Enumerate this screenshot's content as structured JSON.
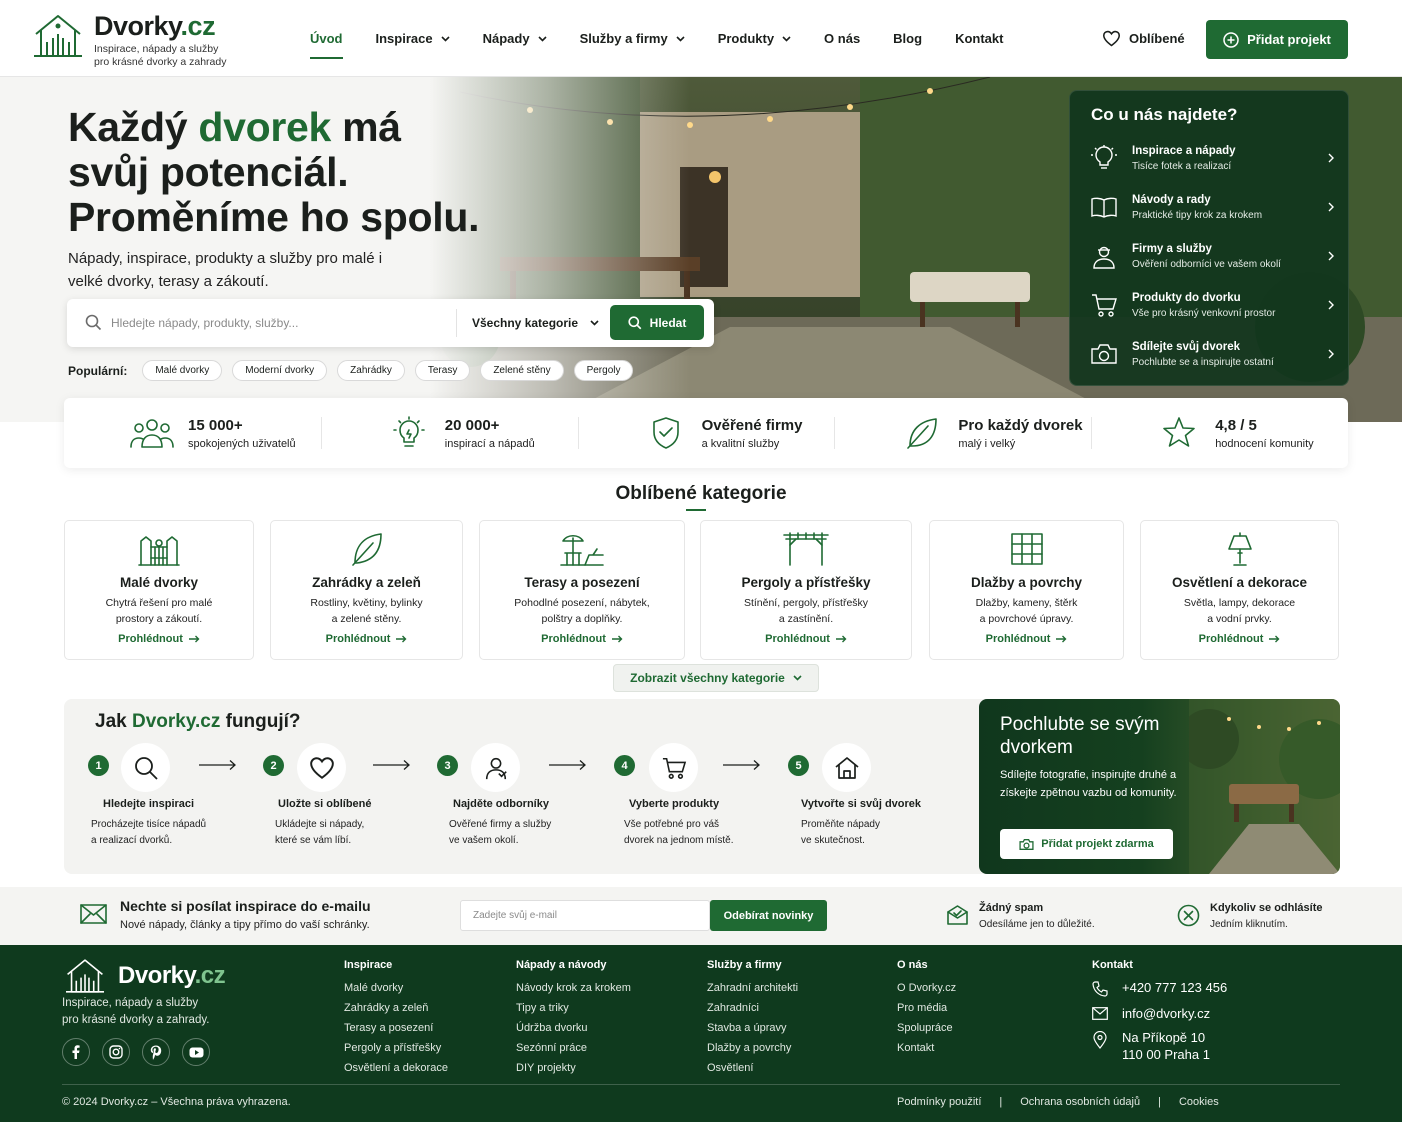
{
  "brand": {
    "name_main": "Dvorky",
    "name_suffix": ".cz",
    "tagline_1": "Inspirace, nápady a služby",
    "tagline_2": "pro krásné dvorky a zahrady"
  },
  "nav": {
    "items": [
      {
        "label": "Úvod",
        "dropdown": false,
        "active": true
      },
      {
        "label": "Inspirace",
        "dropdown": true
      },
      {
        "label": "Nápady",
        "dropdown": true
      },
      {
        "label": "Služby a firmy",
        "dropdown": true
      },
      {
        "label": "Produkty",
        "dropdown": true
      },
      {
        "label": "O nás",
        "dropdown": false
      },
      {
        "label": "Blog",
        "dropdown": false
      },
      {
        "label": "Kontakt",
        "dropdown": false
      }
    ],
    "favorites": "Oblíbené",
    "add_project": "Přidat projekt"
  },
  "hero": {
    "title_1": "Každý ",
    "title_accent": "dvorek",
    "title_2": " má svůj potenciál. Proměníme ho spolu.",
    "subtitle": "Nápady, inspirace, produkty a služby pro malé i velké dvorky, terasy a zákoutí.",
    "search_placeholder": "Hledejte nápady, produkty, služby...",
    "search_category": "Všechny kategorie",
    "search_button": "Hledat",
    "popular_label": "Populární:",
    "popular_tags": [
      "Malé dvorky",
      "Moderní dvorky",
      "Zahrádky",
      "Terasy",
      "Zelené stěny",
      "Pergoly"
    ]
  },
  "panel": {
    "title": "Co u nás najdete?",
    "items": [
      {
        "title": "Inspirace a nápady",
        "sub": "Tisíce fotek a realizací",
        "icon": "lightbulb-icon"
      },
      {
        "title": "Návody a rady",
        "sub": "Praktické tipy krok za krokem",
        "icon": "book-icon"
      },
      {
        "title": "Firmy a služby",
        "sub": "Ověření odborníci ve vašem okolí",
        "icon": "worker-icon"
      },
      {
        "title": "Produkty do dvorku",
        "sub": "Vše pro krásný venkovní prostor",
        "icon": "cart-icon"
      },
      {
        "title": "Sdílejte svůj dvorek",
        "sub": "Pochlubte se a inspirujte ostatní",
        "icon": "camera-icon"
      }
    ]
  },
  "stats": [
    {
      "value": "15 000+",
      "label": "spokojených uživatelů",
      "icon": "users-icon"
    },
    {
      "value": "20 000+",
      "label": "inspirací a nápadů",
      "icon": "lightbulb-icon"
    },
    {
      "value": "Ověřené firmy",
      "label": "a kvalitní služby",
      "icon": "shield-check-icon"
    },
    {
      "value": "Pro každý dvorek",
      "label": "malý i velký",
      "icon": "leaf-icon"
    },
    {
      "value": "4,8 / 5",
      "label": "hodnocení komunity",
      "icon": "star-icon"
    }
  ],
  "categories": {
    "heading": "Oblíbené kategorie",
    "items": [
      {
        "title": "Malé dvorky",
        "desc_1": "Chytrá řešení pro malé",
        "desc_2": "prostory a zákoutí.",
        "link": "Prohlédnout",
        "icon": "yard-fence-icon"
      },
      {
        "title": "Zahrádky a zeleň",
        "desc_1": "Rostliny, květiny, bylinky",
        "desc_2": "a zelené stěny.",
        "link": "Prohlédnout",
        "icon": "leaf-icon"
      },
      {
        "title": "Terasy a posezení",
        "desc_1": "Pohodlné posezení, nábytek,",
        "desc_2": "polštry a doplňky.",
        "link": "Prohlédnout",
        "icon": "umbrella-table-icon"
      },
      {
        "title": "Pergoly a přístřešky",
        "desc_1": "Stínění, pergoly, přístřešky",
        "desc_2": "a zastínění.",
        "link": "Prohlédnout",
        "icon": "pergola-icon"
      },
      {
        "title": "Dlažby a povrchy",
        "desc_1": "Dlažby, kameny, štěrk",
        "desc_2": "a povrchové úpravy.",
        "link": "Prohlédnout",
        "icon": "tiles-icon"
      },
      {
        "title": "Osvětlení a dekorace",
        "desc_1": "Světla, lampy, dekorace",
        "desc_2": "a vodní prvky.",
        "link": "Prohlédnout",
        "icon": "lamp-icon"
      }
    ],
    "show_all": "Zobrazit všechny kategorie"
  },
  "how": {
    "title_1": "Jak ",
    "title_accent": "Dvorky.cz",
    "title_2": " fungují?",
    "steps": [
      {
        "num": "1",
        "title": "Hledejte inspiraci",
        "desc_1": "Procházejte tisíce nápadů",
        "desc_2": "a realizací dvorků.",
        "icon": "search-icon"
      },
      {
        "num": "2",
        "title": "Uložte si oblíbené",
        "desc_1": "Ukládejte si nápady,",
        "desc_2": "které se vám líbí.",
        "icon": "heart-icon"
      },
      {
        "num": "3",
        "title": "Najděte odborníky",
        "desc_1": "Ověřené firmy a služby",
        "desc_2": "ve vašem okolí.",
        "icon": "worker-icon"
      },
      {
        "num": "4",
        "title": "Vyberte produkty",
        "desc_1": "Vše potřebné pro váš",
        "desc_2": "dvorek na jednom místě.",
        "icon": "cart-icon"
      },
      {
        "num": "5",
        "title": "Vytvořte si svůj dvorek",
        "desc_1": "Proměňte nápady",
        "desc_2": "ve skutečnost.",
        "icon": "home-icon"
      }
    ]
  },
  "promo": {
    "title": "Pochlubte se svým dvorkem",
    "desc": "Sdílejte fotografie, inspirujte druhé a získejte zpětnou vazbu od komunity.",
    "button": "Přidat projekt zdarma"
  },
  "newsletter": {
    "title": "Nechte si posílat inspirace do e-mailu",
    "sub": "Nové nápady, články a tipy přímo do vaší schránky.",
    "placeholder": "Zadejte svůj e-mail",
    "button": "Odebírat novinky",
    "feature_1_title": "Žádný spam",
    "feature_1_sub": "Odesíláme jen to důležité.",
    "feature_2_title": "Kdykoliv se odhlásíte",
    "feature_2_sub": "Jedním kliknutím."
  },
  "footer": {
    "tagline_1": "Inspirace, nápady a služby",
    "tagline_2": "pro krásné dvorky a zahrady.",
    "columns": [
      {
        "title": "Inspirace",
        "items": [
          "Malé dvorky",
          "Zahrádky a zeleň",
          "Terasy a posezení",
          "Pergoly a přístřešky",
          "Osvětlení a dekorace"
        ]
      },
      {
        "title": "Nápady a návody",
        "items": [
          "Návody krok za krokem",
          "Tipy a triky",
          "Údržba dvorku",
          "Sezónní práce",
          "DIY projekty"
        ]
      },
      {
        "title": "Služby a firmy",
        "items": [
          "Zahradní architekti",
          "Zahradníci",
          "Stavba a úpravy",
          "Dlažby a povrchy",
          "Osvětlení"
        ]
      },
      {
        "title": "O nás",
        "items": [
          "O Dvorky.cz",
          "Pro média",
          "Spolupráce",
          "Kontakt"
        ]
      }
    ],
    "contact_title": "Kontakt",
    "phone": "+420 777 123 456",
    "email": "info@dvorky.cz",
    "address_1": "Na Příkopě 10",
    "address_2": "110 00 Praha 1",
    "copyright": "© 2024 Dvorky.cz – Všechna práva vyhrazena.",
    "legal": [
      "Podmínky použití",
      "Ochrana osobních údajů",
      "Cookies"
    ],
    "legal_sep": "|"
  },
  "colors": {
    "brand_green": "#1f6a33",
    "dark_green": "#0f3a1e"
  }
}
